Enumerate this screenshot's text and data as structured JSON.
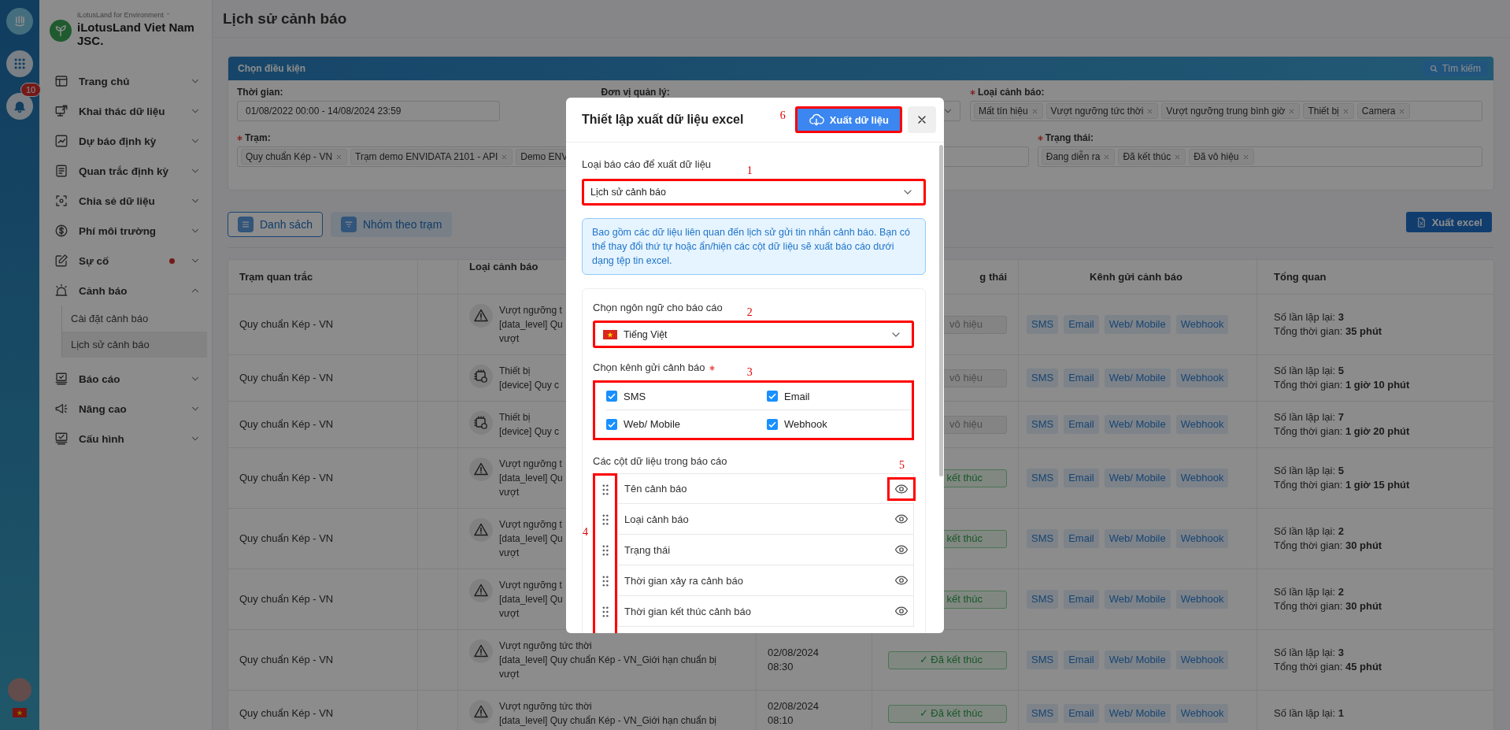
{
  "rail": {
    "notification_count": "10"
  },
  "sidebar": {
    "org_caption": "iLotusLand for Environment",
    "org_name": "iLotusLand Viet Nam JSC.",
    "items": [
      {
        "label": "Trang chủ",
        "expanded": false,
        "alert": false
      },
      {
        "label": "Khai thác dữ liệu",
        "expanded": false,
        "alert": false
      },
      {
        "label": "Dự báo định kỳ",
        "expanded": false,
        "alert": false
      },
      {
        "label": "Quan trắc định kỳ",
        "expanded": false,
        "alert": false
      },
      {
        "label": "Chia sẻ dữ liệu",
        "expanded": false,
        "alert": false
      },
      {
        "label": "Phí môi trường",
        "expanded": false,
        "alert": false
      },
      {
        "label": "Sự cố",
        "expanded": false,
        "alert": true
      },
      {
        "label": "Cảnh báo",
        "expanded": true,
        "alert": false,
        "children": [
          {
            "label": "Cài đặt cảnh báo",
            "selected": false
          },
          {
            "label": "Lịch sử cảnh báo",
            "selected": true
          }
        ]
      },
      {
        "label": "Báo cáo",
        "expanded": false,
        "alert": false
      },
      {
        "label": "Nâng cao",
        "expanded": false,
        "alert": false
      },
      {
        "label": "Cấu hình",
        "expanded": false,
        "alert": false
      }
    ]
  },
  "page": {
    "title": "Lịch sử cảnh báo"
  },
  "filter": {
    "title": "Chọn điều kiện",
    "search_button": "Tìm kiếm",
    "fields": [
      {
        "label": "Thời gian:",
        "required": false,
        "kind": "text",
        "value": "01/08/2022 00:00 - 14/08/2024 23:59"
      },
      {
        "label": "Đơn vị quản lý:",
        "required": false,
        "kind": "select"
      },
      {
        "label": "Loại cảnh báo:",
        "required": true,
        "kind": "tags",
        "tags": [
          "Mất tín hiệu",
          "Vượt ngưỡng tức thời",
          "Vượt ngưỡng trung bình giờ",
          "Thiết bị",
          "Camera"
        ]
      },
      {
        "label": "Trạm:",
        "required": true,
        "kind": "tags",
        "tags": [
          "Quy chuẩn Kép - VN",
          "Trạm demo ENVIDATA 2101 - API",
          {
            "label": "Demo ENV"
          }
        ]
      },
      {
        "label": "Trạng thái:",
        "required": true,
        "kind": "tags",
        "tags": [
          "Đang diễn ra",
          "Đã kết thúc",
          "Đã vô hiệu"
        ]
      }
    ]
  },
  "toolbar": {
    "views": [
      {
        "label": "Danh sách",
        "selected": true
      },
      {
        "label": "Nhóm theo trạm",
        "selected": false
      }
    ],
    "export_button": "Xuất excel"
  },
  "table": {
    "headings": {
      "station": "Trạm quan trắc",
      "alert_type": "Loại cảnh báo",
      "status": "g thái",
      "channels": "Kênh gửi cảnh báo",
      "summary": "Tổng quan"
    },
    "rows": [
      {
        "station": "Quy chuẩn Kép - VN",
        "alert": {
          "kind": "threshold",
          "title": "Vượt ngưỡng t",
          "lines": [
            "[data_level] Qu",
            "vượt"
          ]
        },
        "status": {
          "kind": "disabled",
          "text": "vô hiệu"
        },
        "channels": [
          "SMS",
          "Email",
          "Web/ Mobile",
          "Webhook"
        ],
        "repeat": "Số lần lặp lại: **3**",
        "duration": "Tổng thời gian: **35 phút**"
      },
      {
        "station": "Quy chuẩn Kép - VN",
        "alert": {
          "kind": "device",
          "title": "Thiết bị",
          "lines": [
            "[device] Quy c"
          ]
        },
        "status": {
          "kind": "disabled",
          "text": "vô hiệu"
        },
        "channels": [
          "SMS",
          "Email",
          "Web/ Mobile",
          "Webhook"
        ],
        "repeat": "Số lần lặp lại: **5**",
        "duration": "Tổng thời gian: **1 giờ 10 phút**"
      },
      {
        "station": "Quy chuẩn Kép - VN",
        "alert": {
          "kind": "device",
          "title": "Thiết bị",
          "lines": [
            "[device] Quy c"
          ]
        },
        "status": {
          "kind": "disabled",
          "text": "vô hiệu"
        },
        "channels": [
          "SMS",
          "Email",
          "Web/ Mobile",
          "Webhook"
        ],
        "repeat": "Số lần lặp lại: **7**",
        "duration": "Tổng thời gian: **1 giờ 20 phút**"
      },
      {
        "station": "Quy chuẩn Kép - VN",
        "alert": {
          "kind": "threshold",
          "title": "Vượt ngưỡng t",
          "lines": [
            "[data_level] Qu",
            "vượt"
          ]
        },
        "status": {
          "kind": "ended",
          "text": "kết thúc"
        },
        "channels": [
          "SMS",
          "Email",
          "Web/ Mobile",
          "Webhook"
        ],
        "repeat": "Số lần lặp lại: **5**",
        "duration": "Tổng thời gian: **1 giờ 15 phút**"
      },
      {
        "station": "Quy chuẩn Kép - VN",
        "alert": {
          "kind": "threshold",
          "title": "Vượt ngưỡng t",
          "lines": [
            "[data_level] Qu",
            "vượt"
          ]
        },
        "status": {
          "kind": "ended",
          "text": "kết thúc"
        },
        "channels": [
          "SMS",
          "Email",
          "Web/ Mobile",
          "Webhook"
        ],
        "repeat": "Số lần lặp lại: **2**",
        "duration": "Tổng thời gian: **30 phút**"
      },
      {
        "station": "Quy chuẩn Kép - VN",
        "alert": {
          "kind": "threshold",
          "title": "Vượt ngưỡng t",
          "lines": [
            "[data_level] Qu",
            "vượt"
          ]
        },
        "status": {
          "kind": "ended",
          "text": "kết thúc"
        },
        "channels": [
          "SMS",
          "Email",
          "Web/ Mobile",
          "Webhook"
        ],
        "repeat": "Số lần lặp lại: **2**",
        "duration": "Tổng thời gian: **30 phút**"
      },
      {
        "station": "Quy chuẩn Kép - VN",
        "alert": {
          "kind": "threshold",
          "title": "Vượt ngưỡng tức thời",
          "lines": [
            "[data_level] Quy chuẩn Kép - VN_Giới hạn chuẩn bị",
            "vượt"
          ]
        },
        "time": "02/08/2024 08:30",
        "status": {
          "kind": "ended",
          "text": "✓ Đã kết thúc"
        },
        "channels": [
          "SMS",
          "Email",
          "Web/ Mobile",
          "Webhook"
        ],
        "repeat": "Số lần lặp lại: **3**",
        "duration": "Tổng thời gian: **45 phút**"
      },
      {
        "station": "Quy chuẩn Kép - VN",
        "alert": {
          "kind": "threshold",
          "title": "Vượt ngưỡng tức thời",
          "lines": [
            "[data_level] Quy chuẩn Kép - VN_Giới hạn chuẩn bị"
          ]
        },
        "time": "02/08/2024 08:10",
        "status": {
          "kind": "ended",
          "text": "✓ Đã kết thúc"
        },
        "channels": [
          "SMS",
          "Email",
          "Web/ Mobile",
          "Webhook"
        ],
        "repeat": "Số lần lặp lại: **1**"
      }
    ]
  },
  "export_dialog": {
    "title": "Thiết lập xuất dữ liệu excel",
    "export_button": {
      "label": "Xuất dữ liệu",
      "callout": "6"
    },
    "report_type": {
      "label": "Loại báo cáo để xuất dữ liệu",
      "value": "Lịch sử cảnh báo",
      "callout": "1"
    },
    "info": "Bao gồm các dữ liệu liên quan đến lịch sử gửi tin nhắn cảnh báo. Bạn có thể thay đổi thứ tự hoặc ẩn/hiện các cột dữ liệu sẽ xuất báo cáo dưới dạng tệp tin excel.",
    "language": {
      "label": "Chọn ngôn ngữ cho báo cáo",
      "value": "Tiếng Việt",
      "callout": "2"
    },
    "channels": {
      "label": "Chọn kênh gửi cảnh báo",
      "required": true,
      "callout": "3",
      "options": [
        {
          "label": "SMS",
          "checked": true
        },
        {
          "label": "Email",
          "checked": true
        },
        {
          "label": "Web/ Mobile",
          "checked": true
        },
        {
          "label": "Webhook",
          "checked": true
        }
      ]
    },
    "columns": {
      "label": "Các cột dữ liệu trong báo cáo",
      "handles_callout": "4",
      "items": [
        {
          "label": "Tên cảnh báo",
          "visible": true,
          "callout": "5"
        },
        {
          "label": "Loại cảnh báo",
          "visible": true
        },
        {
          "label": "Trạng thái",
          "visible": true
        },
        {
          "label": "Thời gian xảy ra cảnh báo",
          "visible": true
        },
        {
          "label": "Thời gian kết thúc cảnh báo",
          "visible": true
        }
      ]
    }
  }
}
